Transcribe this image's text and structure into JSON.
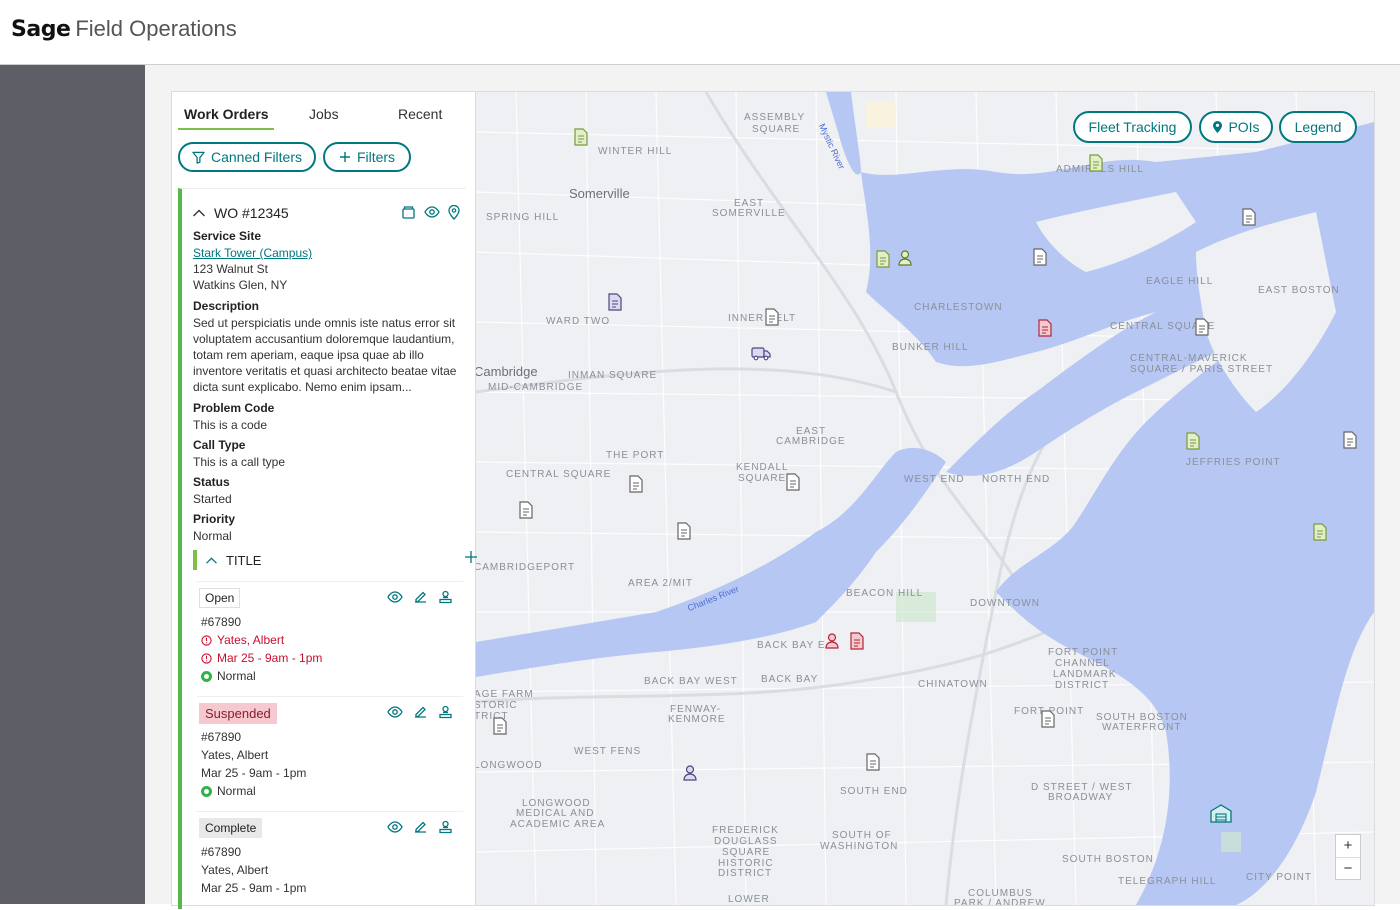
{
  "app": {
    "logo": "Sage",
    "product": "Field Operations"
  },
  "tabs": [
    {
      "label": "Work Orders",
      "active": true
    },
    {
      "label": "Jobs",
      "active": false
    },
    {
      "label": "Recent",
      "active": false
    }
  ],
  "filters": {
    "canned_label": "Canned Filters",
    "filters_label": "Filters"
  },
  "work_order": {
    "number": "WO #12345",
    "service_site_label": "Service Site",
    "site_name": "Stark Tower (Campus)",
    "address1": "123 Walnut St",
    "address2": "Watkins Glen, NY",
    "description_label": "Description",
    "description": "Sed ut perspiciatis unde omnis iste natus error sit voluptatem accusantium doloremque laudantium, totam rem aperiam, eaque ipsa quae ab illo inventore veritatis et quasi architecto beatae vitae dicta sunt explicabo. Nemo enim ipsam...",
    "problem_code_label": "Problem Code",
    "problem_code": "This is a code",
    "call_type_label": "Call Type",
    "call_type": "This is a call type",
    "status_label": "Status",
    "status": "Started",
    "priority_label": "Priority",
    "priority": "Normal",
    "title": "TITLE"
  },
  "sub_items": [
    {
      "status": "Open",
      "id": "#67890",
      "tech": "Yates, Albert",
      "time": "Mar 25 - 9am - 1pm",
      "priority": "Normal"
    },
    {
      "status": "Suspended",
      "id": "#67890",
      "tech": "Yates, Albert",
      "time": "Mar 25 - 9am - 1pm",
      "priority": "Normal"
    },
    {
      "status": "Complete",
      "id": "#67890",
      "tech": "Yates, Albert",
      "time": "Mar 25 - 9am - 1pm"
    }
  ],
  "map": {
    "buttons": {
      "fleet": "Fleet Tracking",
      "pois": "POIs",
      "legend": "Legend"
    },
    "zoom_in": "+",
    "zoom_out": "−",
    "labels": {
      "assembly": "ASSEMBLY",
      "square": "SQUARE",
      "winter_hill": "WINTER HILL",
      "somerville": "Somerville",
      "east": "EAST",
      "somerville_caps": "SOMERVILLE",
      "spring_hill": "SPRING HILL",
      "mystic": "Mystic River",
      "admiral_hill": "ADMIRALS HILL",
      "eagle_hill": "EAGLE HILL",
      "east_boston": "EAST BOSTON",
      "charlestown": "CHARLESTOWN",
      "bunker_hill": "BUNKER HILL",
      "central_sq": "CENTRAL SQUARE",
      "cm1": "CENTRAL-MAVERICK",
      "cm2": "SQUARE / PARIS STREET",
      "ward_two": "WARD TWO",
      "inner_belt": "INNER BELT",
      "cambridge": "Cambridge",
      "mid_cambridge": "MID-CAMBRIDGE",
      "inman": "INMAN SQUARE",
      "east2": "EAST",
      "east_cambridge": "CAMBRIDGE",
      "jeffries": "JEFFRIES POINT",
      "the_port": "THE PORT",
      "kendall": "KENDALL",
      "kendall_sq": "SQUARE",
      "west_end": "WEST END",
      "north_end": "NORTH END",
      "central_square2": "CENTRAL SQUARE",
      "cambridgeport": "CAMBRIDGEPORT",
      "area2": "AREA 2/MIT",
      "charles": "Charles River",
      "beacon_hill": "BEACON HILL",
      "downtown": "DOWNTOWN",
      "back_bay_e": "BACK BAY E",
      "fort_point1": "FORT POINT",
      "fort_point2": "CHANNEL",
      "fort_point3": "LANDMARK",
      "fort_point4": "DISTRICT",
      "back_bay_west": "BACK BAY WEST",
      "back_bay": "BACK BAY",
      "chinatown": "CHINATOWN",
      "age_farm": "AGE FARM",
      "storic": "STORIC",
      "trict": "TRICT",
      "fenway": "FENWAY-",
      "kenmore": "KENMORE",
      "fort_point5": "FORT POINT",
      "south_boston_wf1": "SOUTH BOSTON",
      "south_boston_wf2": "WATERFRONT",
      "west_fens": "WEST FENS",
      "longwood": "LONGWOOD",
      "south_end": "SOUTH END",
      "dstreet1": "D STREET / WEST",
      "dstreet2": "BROADWAY",
      "lma1": "LONGWOOD",
      "lma2": "MEDICAL AND",
      "lma3": "ACADEMIC AREA",
      "fd1": "FREDERICK",
      "fd2": "DOUGLASS",
      "fd3": "SQUARE",
      "fd4": "HISTORIC",
      "fd5": "DISTRICT",
      "sw1": "SOUTH OF",
      "sw2": "WASHINGTON",
      "south_boston": "SOUTH BOSTON",
      "telegraph": "TELEGRAPH HILL",
      "city_point": "CITY POINT",
      "columbus": "COLUMBUS",
      "park": "PARK / ANDREW",
      "lower": "LOWER"
    }
  }
}
